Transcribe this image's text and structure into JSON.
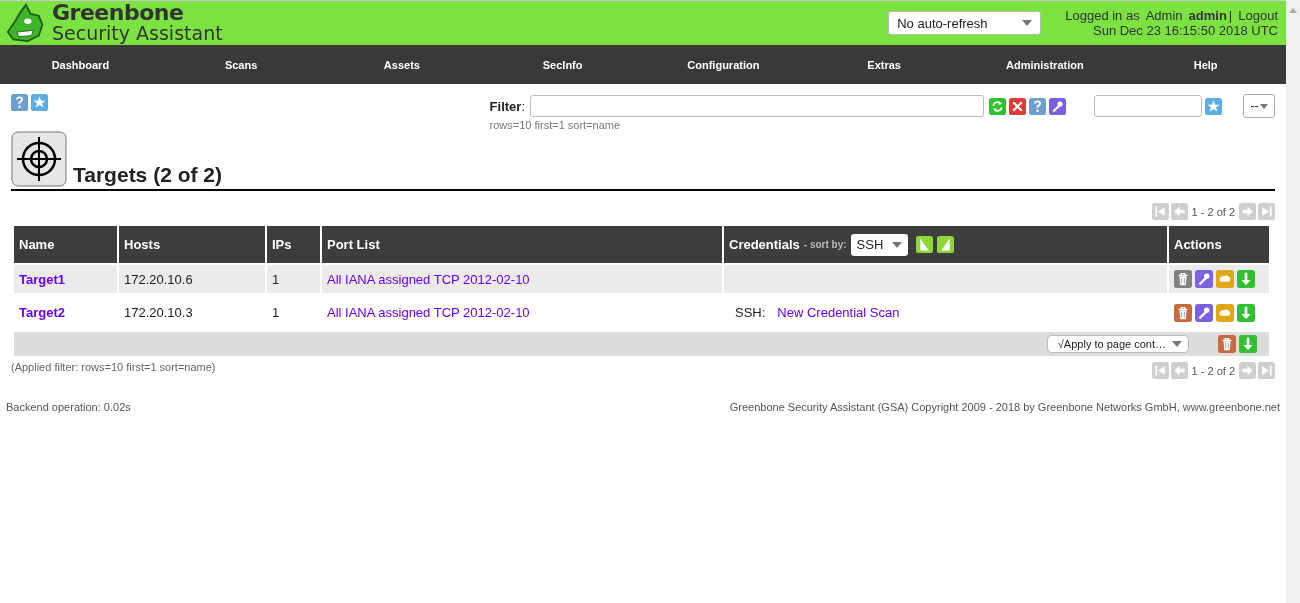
{
  "header": {
    "brand_line1": "Greenbone",
    "brand_line2": "Security Assistant",
    "refresh": "No auto-refresh",
    "logged_in_label": "Logged in as",
    "role": "Admin",
    "user": "admin",
    "separator": "|",
    "logout": "Logout",
    "datetime": "Sun Dec 23 16:15:50 2018 UTC"
  },
  "nav": [
    "Dashboard",
    "Scans",
    "Assets",
    "SecInfo",
    "Configuration",
    "Extras",
    "Administration",
    "Help"
  ],
  "filter": {
    "label": "Filter",
    "colon": ":",
    "hint": "rows=10 first=1 sort=name",
    "select": "--"
  },
  "title": "Targets (2 of 2)",
  "pagination_top": "1 - 2 of 2",
  "pagination_bottom": "1 - 2 of 2",
  "table": {
    "columns": [
      "Name",
      "Hosts",
      "IPs",
      "Port List",
      "Credentials",
      "Actions"
    ],
    "sort_by_label": "- sort by:",
    "sort_by": "SSH",
    "rows": [
      {
        "name": "Target1",
        "hosts": "172.20.10.6",
        "ips": "1",
        "port_list": "All IANA assigned TCP 2012-02-10",
        "cred_type": "",
        "cred_name": "",
        "deletable": false
      },
      {
        "name": "Target2",
        "hosts": "172.20.10.3",
        "ips": "1",
        "port_list": "All IANA assigned TCP 2012-02-10",
        "cred_type": "SSH:",
        "cred_name": "New Credential Scan",
        "deletable": true
      }
    ],
    "bulk_action": "√Apply to page cont…"
  },
  "applied_filter": "(Applied filter: rows=10 first=1 sort=name)",
  "footer": {
    "backend": "Backend operation: 0.02s",
    "copyright": "Greenbone Security Assistant (GSA) Copyright 2009 - 2018 by Greenbone Networks GmbH, www.greenbone.net"
  }
}
